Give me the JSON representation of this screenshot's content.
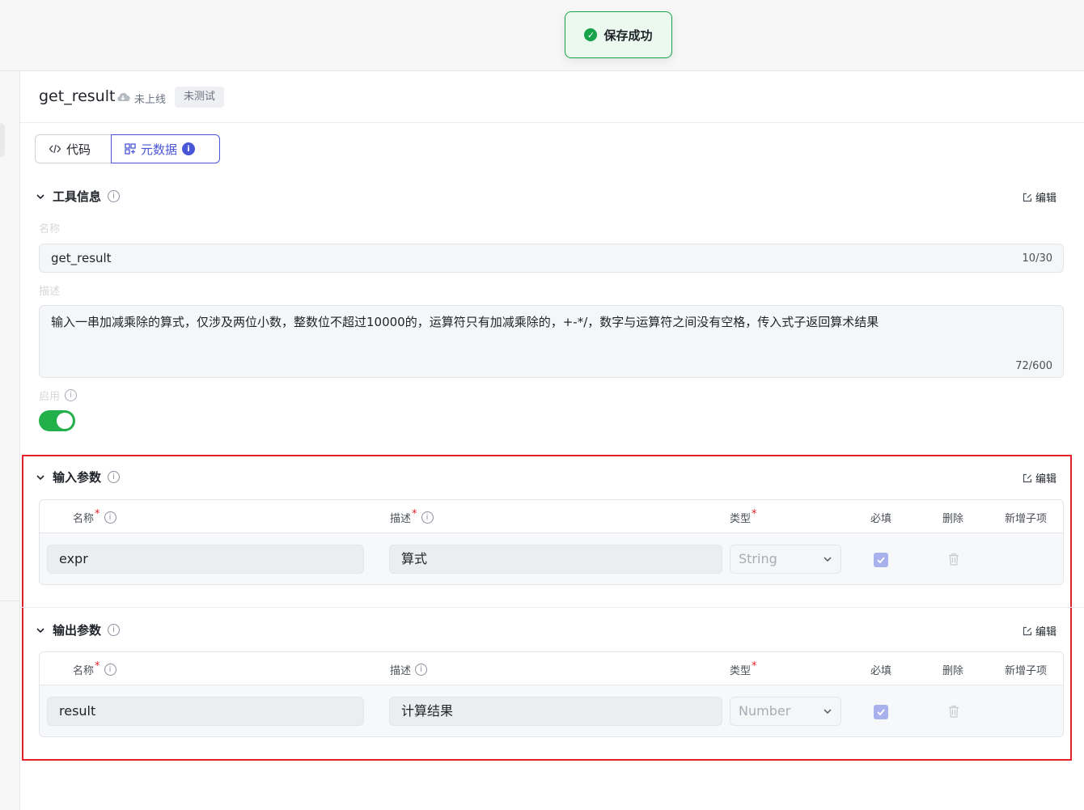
{
  "toast": {
    "message": "保存成功",
    "icon": "check-circle-icon",
    "color": "#16a34a"
  },
  "header": {
    "tool_name": "get_result",
    "status_text": "未上线",
    "status_icon": "cloud-icon",
    "test_tag": "未测试"
  },
  "tabs": [
    {
      "label": "代码",
      "icon": "code-icon"
    },
    {
      "label": "元数据",
      "icon": "grid-icon",
      "badge": "i",
      "active": true
    }
  ],
  "tool_info": {
    "title": "工具信息",
    "edit_label": "编辑",
    "name_label": "名称",
    "name_value": "get_result",
    "name_count": "10/30",
    "desc_label": "描述",
    "desc_value": "输入一串加减乘除的算式，仅涉及两位小数，整数位不超过10000的，运算符只有加减乘除的，+-*/，数字与运算符之间没有空格，传入式子返回算术结果",
    "desc_count": "72/600",
    "enable_label": "启用",
    "enabled": true
  },
  "input_params": {
    "title": "输入参数",
    "edit_label": "编辑",
    "columns": {
      "name": "名称",
      "desc": "描述",
      "type": "类型",
      "required": "必填",
      "delete": "删除",
      "add_child": "新增子项"
    },
    "rows": [
      {
        "name": "expr",
        "desc": "算式",
        "type": "String",
        "required": true
      }
    ]
  },
  "output_params": {
    "title": "输出参数",
    "edit_label": "编辑",
    "columns": {
      "name": "名称",
      "desc": "描述",
      "type": "类型",
      "required": "必填",
      "delete": "删除",
      "add_child": "新增子项"
    },
    "rows": [
      {
        "name": "result",
        "desc": "计算结果",
        "type": "Number",
        "required": true
      }
    ]
  },
  "colors": {
    "accent": "#4a56d6",
    "toggle_on": "#22b04b",
    "highlight": "#e0202a"
  }
}
